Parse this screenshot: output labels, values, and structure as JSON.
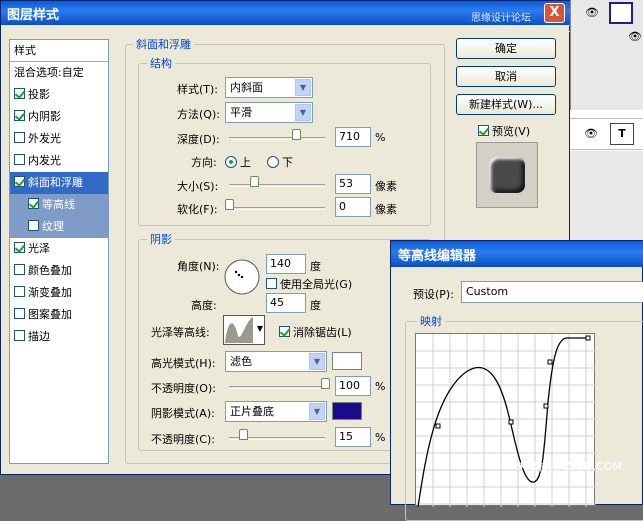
{
  "dialog": {
    "title": "图层样式",
    "watermark": "思缘设计论坛 WWW.MISSYUAN.COM",
    "close_glyph": "X"
  },
  "style_list": {
    "header": "样式",
    "items": [
      {
        "label": "混合选项:自定",
        "checkbox": false,
        "checked": false,
        "state": "normal"
      },
      {
        "label": "投影",
        "checkbox": true,
        "checked": true,
        "state": "normal"
      },
      {
        "label": "内阴影",
        "checkbox": true,
        "checked": true,
        "state": "normal"
      },
      {
        "label": "外发光",
        "checkbox": true,
        "checked": false,
        "state": "normal"
      },
      {
        "label": "内发光",
        "checkbox": true,
        "checked": false,
        "state": "normal"
      },
      {
        "label": "斜面和浮雕",
        "checkbox": true,
        "checked": true,
        "state": "selected"
      },
      {
        "label": "等高线",
        "checkbox": true,
        "checked": true,
        "state": "sub"
      },
      {
        "label": "纹理",
        "checkbox": true,
        "checked": false,
        "state": "sub"
      },
      {
        "label": "光泽",
        "checkbox": true,
        "checked": true,
        "state": "normal"
      },
      {
        "label": "颜色叠加",
        "checkbox": true,
        "checked": false,
        "state": "normal"
      },
      {
        "label": "渐变叠加",
        "checkbox": true,
        "checked": false,
        "state": "normal"
      },
      {
        "label": "图案叠加",
        "checkbox": true,
        "checked": false,
        "state": "normal"
      },
      {
        "label": "描边",
        "checkbox": true,
        "checked": false,
        "state": "normal"
      }
    ]
  },
  "bevel": {
    "group_label": "斜面和浮雕",
    "structure": {
      "label": "结构",
      "style_label": "样式(T):",
      "style_value": "内斜面",
      "method_label": "方法(Q):",
      "method_value": "平滑",
      "depth_label": "深度(D):",
      "depth_value": "710",
      "depth_unit": "%",
      "depth_pct": 0.7,
      "direction_label": "方向:",
      "dir_up": "上",
      "dir_down": "下",
      "size_label": "大小(S):",
      "size_value": "53",
      "size_unit": "像素",
      "size_pct": 0.26,
      "soften_label": "软化(F):",
      "soften_value": "0",
      "soften_unit": "像素",
      "soften_pct": 0.0
    },
    "shading": {
      "label": "阴影",
      "angle_label": "角度(N):",
      "angle_value": "140",
      "angle_unit": "度",
      "global_light_label": "使用全局光(G)",
      "global_light_checked": false,
      "altitude_label": "高度:",
      "altitude_value": "45",
      "altitude_unit": "度",
      "gloss_label": "光泽等高线:",
      "antialias_label": "消除锯齿(L)",
      "antialias_checked": true,
      "highlight_label": "高光模式(H):",
      "highlight_value": "滤色",
      "highlight_color": "#ffffff",
      "hl_opacity_label": "不透明度(O):",
      "hl_opacity_value": "100",
      "hl_opacity_unit": "%",
      "hl_opacity_pct": 1.0,
      "shadow_label": "阴影模式(A):",
      "shadow_value": "正片叠底",
      "shadow_color": "#1a0a8c",
      "sh_opacity_label": "不透明度(C):",
      "sh_opacity_value": "15",
      "sh_opacity_unit": "%",
      "sh_opacity_pct": 0.15
    }
  },
  "buttons": {
    "ok": "确定",
    "cancel": "取消",
    "new_style": "新建样式(W)...",
    "preview_label": "预览(V)",
    "preview_checked": true
  },
  "contour_editor": {
    "title": "等高线编辑器",
    "preset_label": "预设(P):",
    "preset_value": "Custom",
    "mapping_label": "映射"
  },
  "watermark2": "朱峰社区 ZFSD.COM"
}
